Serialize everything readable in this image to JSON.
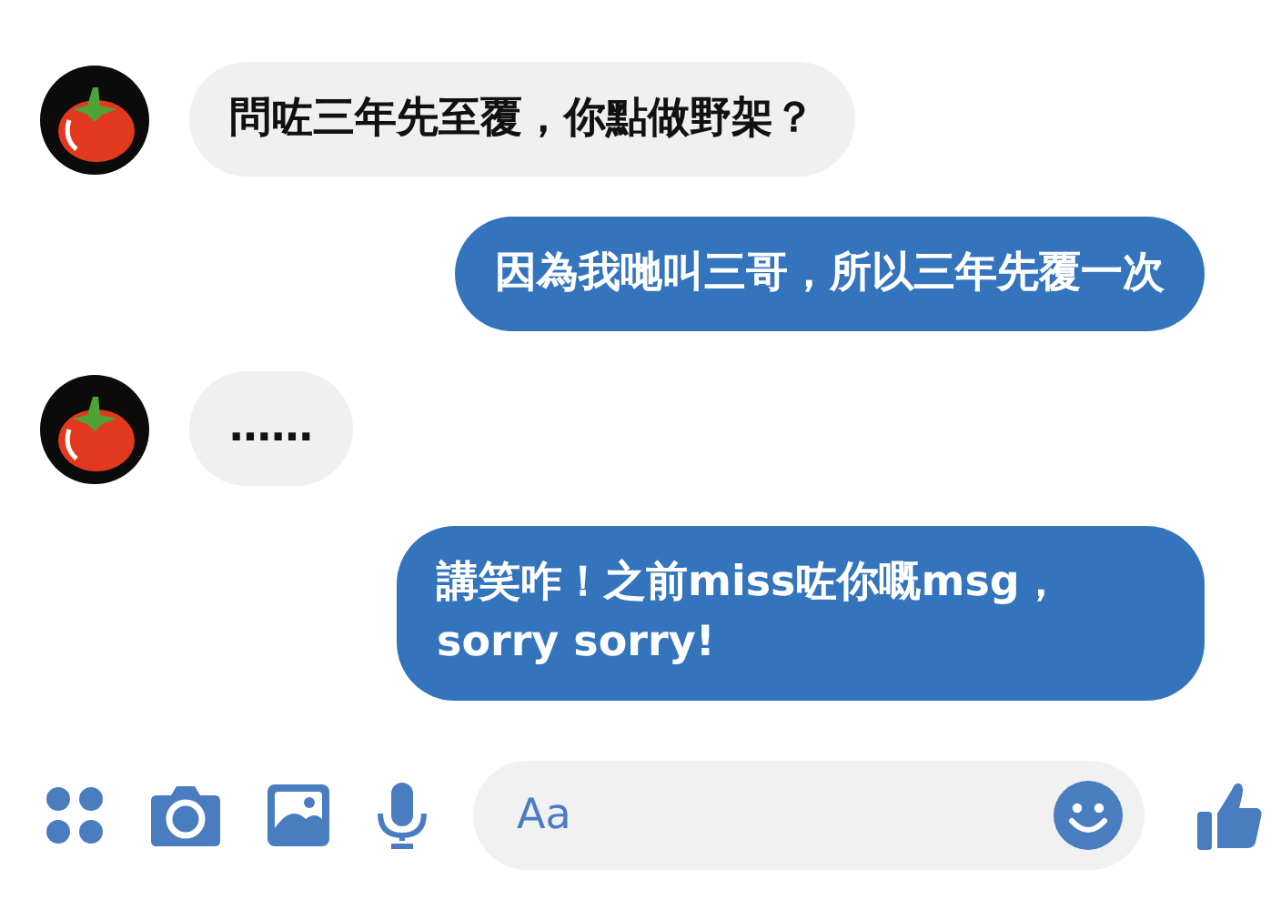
{
  "messages": [
    {
      "kind": "received",
      "text": "問咗三年先至覆，你點做野架？"
    },
    {
      "kind": "sent",
      "text": "因為我哋叫三哥，所以三年先覆一次"
    },
    {
      "kind": "received",
      "text": "……"
    },
    {
      "kind": "sent",
      "text": "講笑咋！之前miss咗你嘅msg，sorry sorry!"
    }
  ],
  "composer": {
    "placeholder": "Aa"
  }
}
